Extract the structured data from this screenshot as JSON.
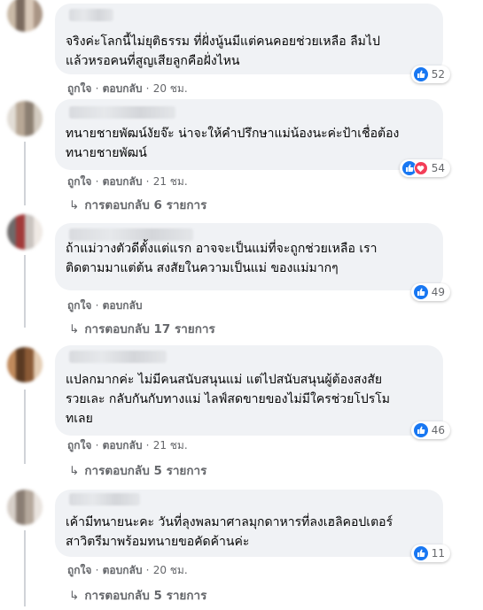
{
  "like_label": "ถูกใจ",
  "reply_label": "ตอบกลับ",
  "separator": "·",
  "comments": [
    {
      "text": "จริงค่ะโลกนี้ไม่ยุติธรรม ที่ฝั่งนู้นมีแต่คนคอยช่วยเหลือ ลืมไป\nแล้วหรอคนที่สูญเสียลูกคือฝั่งไหน",
      "time": "20 ชม.",
      "reaction_count": "52",
      "reactions": [
        "like"
      ],
      "replies": ""
    },
    {
      "text": "ทนายชายพัฒน์งัยจ๊ะ น่าจะให้คำปรึกษาแม่น้องนะค่ะป้าเชื่อต้อง\nทนายชายพัฒน์",
      "time": "21 ชม.",
      "reaction_count": "54",
      "reactions": [
        "like",
        "love"
      ],
      "replies": "การตอบกลับ 6 รายการ"
    },
    {
      "text": "ถ้าแม่วางตัวดีตั้งแต่แรก อาจจะเป็นแม่ที่จะถูกช่วยเหลือ เรา\nติดตามมาแต่ต้น สงสัยในความเป็นแม่ ของแม่มากๆ",
      "time": "",
      "reaction_count": "49",
      "reactions": [
        "like"
      ],
      "replies": "การตอบกลับ 17 รายการ"
    },
    {
      "text": "แปลกมากค่ะ ไม่มีคนสนับสนุนแม่ แต่ไปสนับสนุนผู้ต้องสงสัย\nรวยเละ กลับกันกับทางแม่ ไลฟ์สดขายของไม่มีใครช่วยโปรโม\nทเลย",
      "time": "21 ชม.",
      "reaction_count": "46",
      "reactions": [
        "like"
      ],
      "replies": "การตอบกลับ 5 รายการ"
    },
    {
      "text": "เค้ามีทนายนะคะ วันที่ลุงพลมาศาลมุกดาหารที่ลงเฮลิคอปเตอร์\nสาวิตรีมาพร้อมทนายขอคัดค้านค่ะ",
      "time": "20 ชม.",
      "reaction_count": "11",
      "reactions": [
        "like"
      ],
      "replies": "การตอบกลับ 5 รายการ"
    }
  ]
}
